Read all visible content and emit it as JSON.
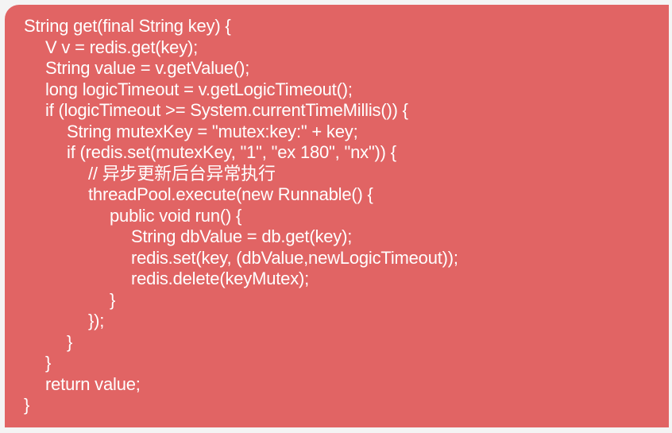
{
  "code": {
    "background_color": "#e16464",
    "text_color": "#ffffff",
    "lines": [
      {
        "indent": 0,
        "text": "String get(final String key) {"
      },
      {
        "indent": 1,
        "text": "V v = redis.get(key);"
      },
      {
        "indent": 1,
        "text": "String value = v.getValue();"
      },
      {
        "indent": 1,
        "text": "long logicTimeout = v.getLogicTimeout();"
      },
      {
        "indent": 1,
        "text": "if (logicTimeout >= System.currentTimeMillis()) {"
      },
      {
        "indent": 2,
        "text": "String mutexKey = \"mutex:key:\" + key;"
      },
      {
        "indent": 2,
        "text": "if (redis.set(mutexKey, \"1\", \"ex 180\", \"nx\")) {"
      },
      {
        "indent": 3,
        "text": "// 异步更新后台异常执行"
      },
      {
        "indent": 3,
        "text": "threadPool.execute(new Runnable() {"
      },
      {
        "indent": 4,
        "text": "public void run() {"
      },
      {
        "indent": 5,
        "text": "String dbValue = db.get(key);"
      },
      {
        "indent": 5,
        "text": "redis.set(key, (dbValue,newLogicTimeout));"
      },
      {
        "indent": 5,
        "text": "redis.delete(keyMutex);"
      },
      {
        "indent": 4,
        "text": "}"
      },
      {
        "indent": 3,
        "text": "});"
      },
      {
        "indent": 2,
        "text": "}"
      },
      {
        "indent": 1,
        "text": "}"
      },
      {
        "indent": 1,
        "text": "return value;"
      },
      {
        "indent": 0,
        "text": "}"
      }
    ]
  }
}
